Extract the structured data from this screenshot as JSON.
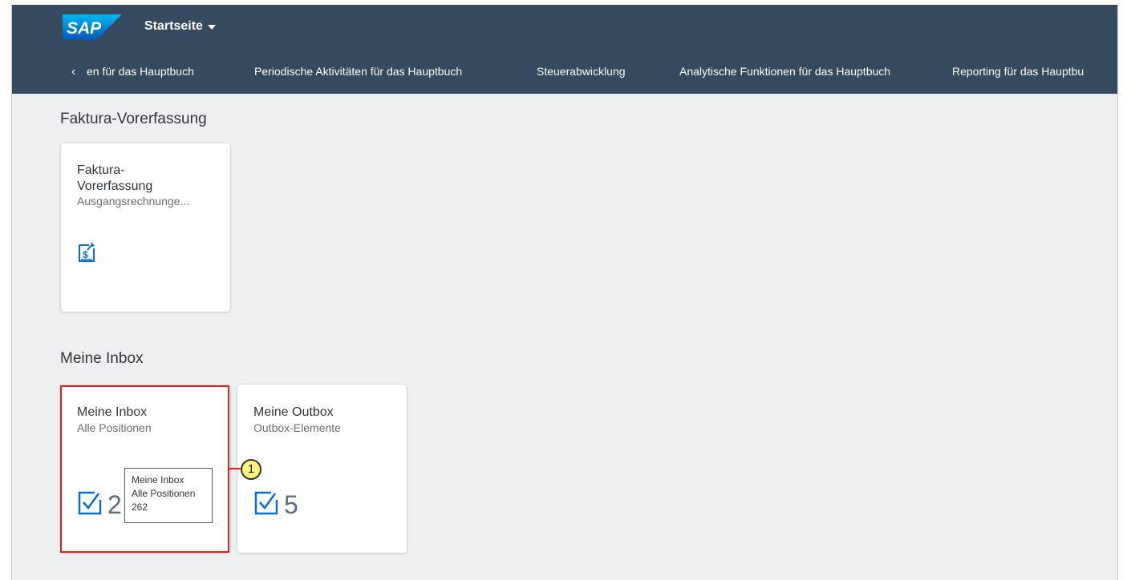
{
  "shell": {
    "logo": "SAP",
    "home_title": "Startseite",
    "back_icon": "chevron-left-icon",
    "tabs": [
      "en für das Hauptbuch",
      "Periodische Aktivitäten für das Hauptbuch",
      "Steuerabwicklung",
      "Analytische Funktionen für das Hauptbuch",
      "Reporting für das Hauptbu"
    ]
  },
  "sections": [
    {
      "title": "Faktura-Vorerfassung",
      "tiles": [
        {
          "title_line1": "Faktura-",
          "title_line2": "Vorerfassung",
          "subtitle": "Ausgangsrechnunge...",
          "icon": "billing-document-icon"
        }
      ]
    },
    {
      "title": "Meine Inbox",
      "tiles": [
        {
          "title": "Meine Inbox",
          "subtitle": "Alle Positionen",
          "icon": "task-checkbox-icon",
          "count": "2"
        },
        {
          "title": "Meine Outbox",
          "subtitle": "Outbox-Elemente",
          "icon": "task-checkbox-icon",
          "count": "5"
        }
      ]
    }
  ],
  "tooltip": {
    "line1": "Meine Inbox",
    "line2": "Alle Positionen",
    "line3": "262"
  },
  "annotation": {
    "callout_number": "1"
  },
  "colors": {
    "shell_bg": "#354a5f",
    "page_bg": "#edeff0",
    "icon_blue": "#0a6ed1",
    "highlight_red": "#e02020",
    "callout_yellow": "#fff27a"
  }
}
